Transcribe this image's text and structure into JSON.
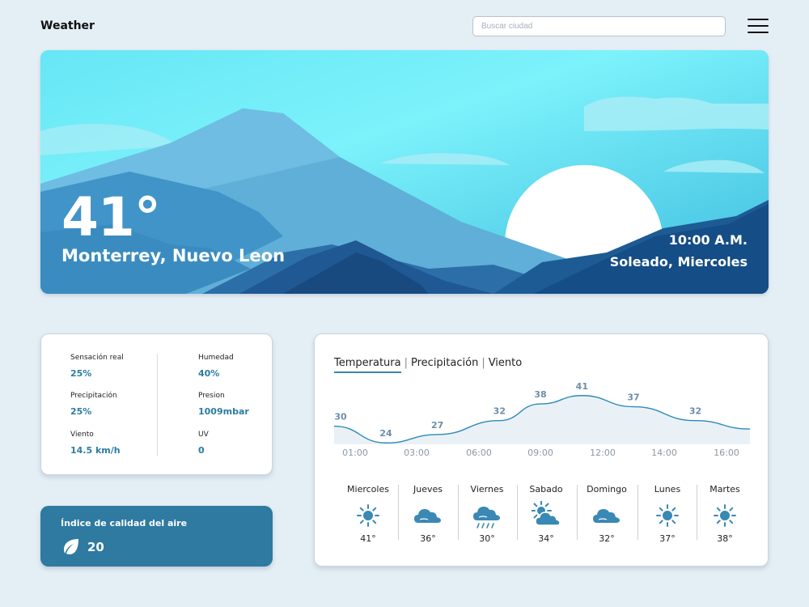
{
  "app": {
    "title": "Weather"
  },
  "search": {
    "placeholder": "Buscar ciudad"
  },
  "hero": {
    "temperature": "41°",
    "city": "Monterrey, Nuevo Leon",
    "time": "10:00 A.M.",
    "condition": "Soleado, Miercoles"
  },
  "stats": {
    "items": [
      {
        "label": "Sensación real",
        "value": "25%"
      },
      {
        "label": "Humedad",
        "value": "40%"
      },
      {
        "label": "Precipitación",
        "value": "25%"
      },
      {
        "label": "Presion",
        "value": "1009mbar"
      },
      {
        "label": "Viento",
        "value": "14.5 km/h"
      },
      {
        "label": "UV",
        "value": "0"
      }
    ]
  },
  "air_quality": {
    "title": "Índice de calidad del aire",
    "value": "20",
    "icon": "leaf-icon"
  },
  "tabs": [
    {
      "label": "Temperatura",
      "active": true
    },
    {
      "label": "Precipitación",
      "active": false
    },
    {
      "label": "Viento",
      "active": false
    }
  ],
  "chart_data": {
    "type": "area",
    "title": "",
    "xlabel": "",
    "ylabel": "",
    "x": [
      "01:00",
      "03:00",
      "06:00",
      "09:00",
      "12:00",
      "14:00",
      "16:00"
    ],
    "points": [
      {
        "x": "00:00",
        "y": 30
      },
      {
        "x": "02:00",
        "y": 24
      },
      {
        "x": "04:00",
        "y": 27
      },
      {
        "x": "07:00",
        "y": 32
      },
      {
        "x": "09:00",
        "y": 38
      },
      {
        "x": "11:00",
        "y": 41
      },
      {
        "x": "13:00",
        "y": 37
      },
      {
        "x": "15:00",
        "y": 32
      }
    ],
    "ylim": [
      20,
      45
    ],
    "grid": false,
    "line_color": "#2e8ab8",
    "fill_color": "#eaf1f6"
  },
  "days": [
    {
      "name": "Miercoles",
      "icon": "sun-icon",
      "temp": "41°"
    },
    {
      "name": "Jueves",
      "icon": "cloudy-icon",
      "temp": "36°"
    },
    {
      "name": "Viernes",
      "icon": "rain-icon",
      "temp": "30°"
    },
    {
      "name": "Sabado",
      "icon": "partly-cloudy-icon",
      "temp": "34°"
    },
    {
      "name": "Domingo",
      "icon": "cloudy-icon",
      "temp": "32°"
    },
    {
      "name": "Lunes",
      "icon": "sun-icon",
      "temp": "37°"
    },
    {
      "name": "Martes",
      "icon": "sun-icon",
      "temp": "38°"
    }
  ],
  "colors": {
    "accent": "#2e7aa0",
    "value_text": "#2c7ba3",
    "icon": "#3a88b4",
    "background": "#e4eef5"
  }
}
